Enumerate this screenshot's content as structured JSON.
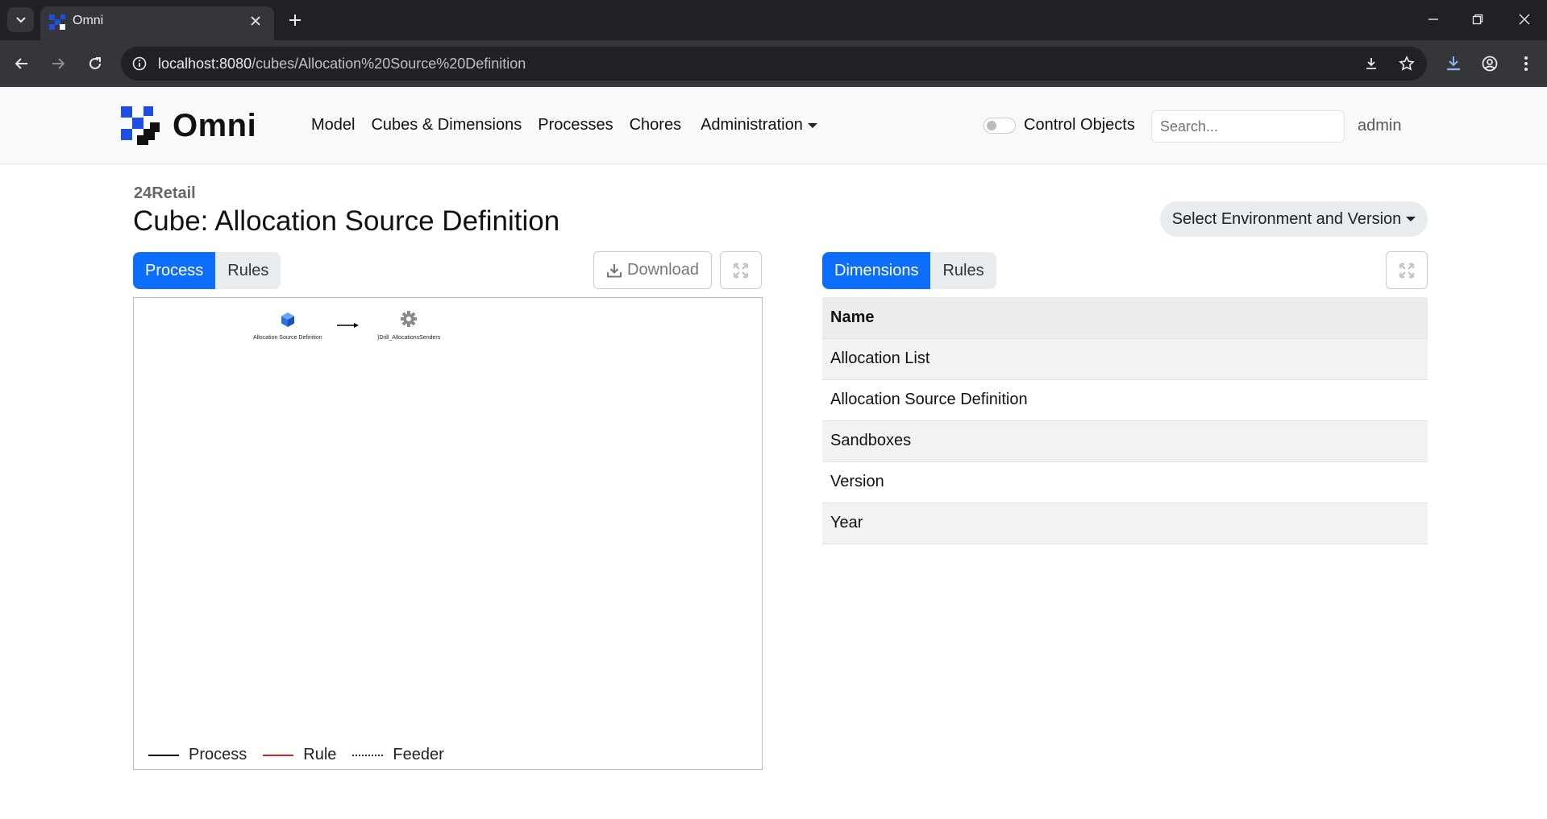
{
  "browser": {
    "tab_title": "Omni",
    "url_host": "localhost:8080",
    "url_path": "/cubes/Allocation%20Source%20Definition",
    "icons": [
      "tab-search-icon",
      "close-icon",
      "plus-icon",
      "minimize-icon",
      "restore-icon",
      "close-window-icon",
      "back-icon",
      "forward-icon",
      "reload-icon",
      "info-icon",
      "download-icon",
      "star-icon",
      "downloads-icon",
      "profile-icon",
      "more-icon"
    ]
  },
  "navbar": {
    "brand": "Omni",
    "links": [
      "Model",
      "Cubes & Dimensions",
      "Processes",
      "Chores",
      "Administration"
    ],
    "control_objects_label": "Control Objects",
    "control_objects_on": false,
    "search_placeholder": "Search...",
    "user": "admin"
  },
  "page": {
    "breadcrumb": "24Retail",
    "title": "Cube: Allocation Source Definition",
    "env_button": "Select Environment and Version"
  },
  "left_panel": {
    "tabs": [
      {
        "label": "Process",
        "active": true
      },
      {
        "label": "Rules",
        "active": false
      }
    ],
    "download_label": "Download",
    "graph": {
      "nodes": [
        {
          "label": "Allocation Source Definition",
          "icon": "cube-icon"
        },
        {
          "label": "}Drill_AllocationsSenders",
          "icon": "gear-icon"
        }
      ],
      "edges": [
        {
          "from": 0,
          "to": 1,
          "type": "Process"
        }
      ]
    },
    "legend": [
      {
        "label": "Process",
        "color": "#000000",
        "style": "solid"
      },
      {
        "label": "Rule",
        "color": "#e02020",
        "style": "solid"
      },
      {
        "label": "Feeder",
        "color": "#1a1aa6",
        "style": "dotted"
      }
    ]
  },
  "right_panel": {
    "tabs": [
      {
        "label": "Dimensions",
        "active": true
      },
      {
        "label": "Rules",
        "active": false
      }
    ],
    "table": {
      "header": "Name",
      "rows": [
        "Allocation List",
        "Allocation Source Definition",
        "Sandboxes",
        "Version",
        "Year"
      ]
    }
  },
  "colors": {
    "primary": "#0d6efd",
    "brand_blue": "#1f4fe0"
  }
}
